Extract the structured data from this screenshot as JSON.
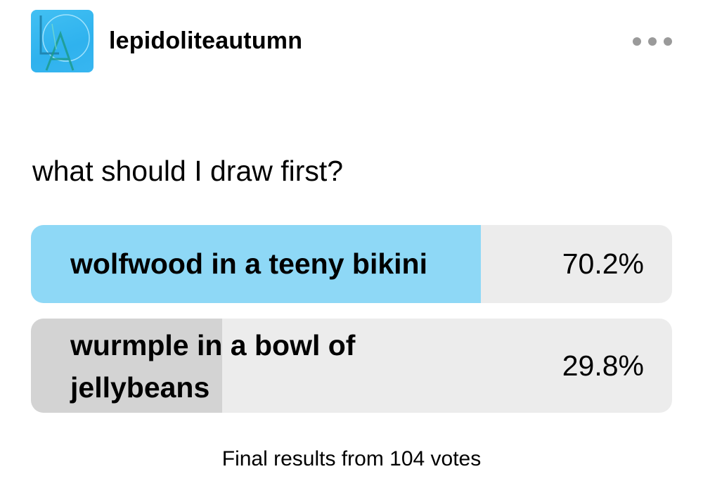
{
  "post": {
    "username": "lepidoliteautumn",
    "avatar_icon": "LA-monogram-avatar",
    "more_icon": "more-options-ellipsis-icon",
    "question": "what should I draw first?"
  },
  "poll": {
    "options": [
      {
        "label": "wolfwood in a teeny bikini",
        "percent_text": "70.2%",
        "percent": 70.2,
        "highlight_color": "#8ed8f6"
      },
      {
        "label": "wurmple in a bowl of jellybeans",
        "percent_text": "29.8%",
        "percent": 29.8,
        "highlight_color": "#d3d3d3"
      }
    ],
    "footer": "Final results from 104 votes"
  }
}
